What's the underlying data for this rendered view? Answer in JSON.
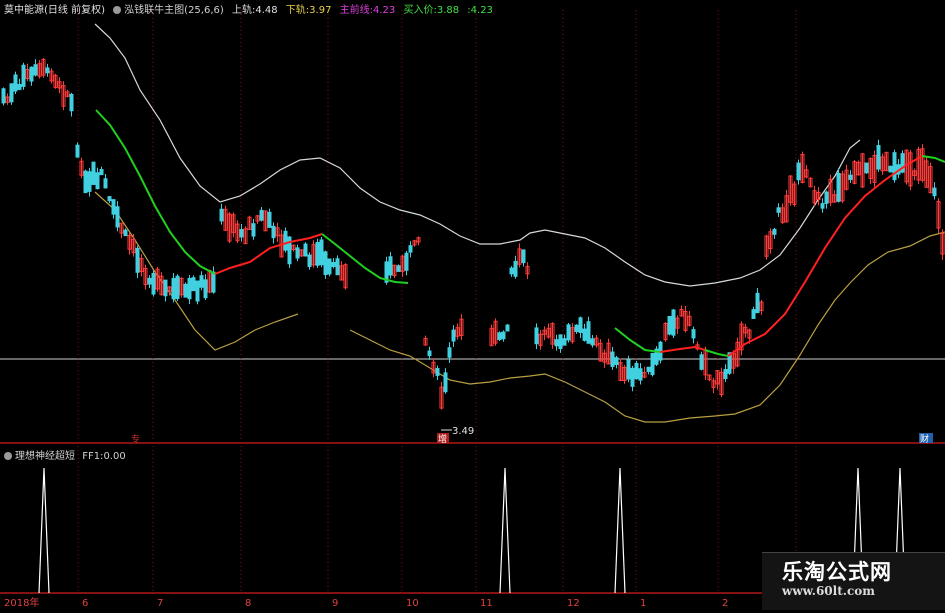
{
  "header": {
    "title": "莫中能源(日线 前复权)",
    "indicator": "泓钱联牛主图(25,6,6)",
    "upper_label": "上轨:",
    "upper_value": "4.48",
    "lower_label": "下轨:",
    "lower_value": "3.97",
    "main_label": "主前线:",
    "main_value": "4.23",
    "buy_label": "买入价:",
    "buy_value": "3.88",
    "extra_value": "4.23"
  },
  "sub_header": {
    "title": "理想神经超短",
    "ff_label": "FF1:",
    "ff_value": "0.00"
  },
  "colors": {
    "up": "#ff3b3b",
    "down": "#40d0e0",
    "upper_band": "#d8d8d8",
    "lower_band": "#b8a040",
    "mid_up": "#ff2020",
    "mid_down": "#20d020",
    "signal": "#ffffff",
    "grid": "#8a1010",
    "hline": "#cfcfcf"
  },
  "chart_data": {
    "type": "candlestick",
    "annotations": {
      "low_price": "3.49",
      "marker_mid": "增",
      "marker_left": "专",
      "marker_right": "财"
    },
    "x_axis_labels": [
      "2018年",
      "6",
      "7",
      "8",
      "9",
      "10",
      "11",
      "12",
      "1",
      "2"
    ],
    "sub_signal_values": [
      1,
      1,
      1,
      1,
      1
    ],
    "watermark": {
      "title": "乐淘公式网",
      "url": "www.60lt.com"
    }
  }
}
